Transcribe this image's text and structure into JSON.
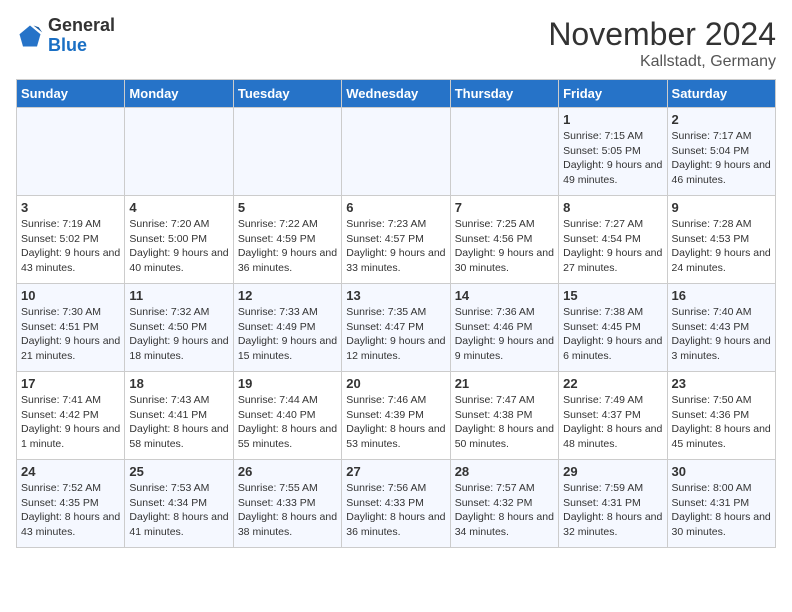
{
  "logo": {
    "general": "General",
    "blue": "Blue"
  },
  "header": {
    "month": "November 2024",
    "location": "Kallstadt, Germany"
  },
  "days_of_week": [
    "Sunday",
    "Monday",
    "Tuesday",
    "Wednesday",
    "Thursday",
    "Friday",
    "Saturday"
  ],
  "weeks": [
    [
      {
        "day": "",
        "info": ""
      },
      {
        "day": "",
        "info": ""
      },
      {
        "day": "",
        "info": ""
      },
      {
        "day": "",
        "info": ""
      },
      {
        "day": "",
        "info": ""
      },
      {
        "day": "1",
        "info": "Sunrise: 7:15 AM\nSunset: 5:05 PM\nDaylight: 9 hours and 49 minutes."
      },
      {
        "day": "2",
        "info": "Sunrise: 7:17 AM\nSunset: 5:04 PM\nDaylight: 9 hours and 46 minutes."
      }
    ],
    [
      {
        "day": "3",
        "info": "Sunrise: 7:19 AM\nSunset: 5:02 PM\nDaylight: 9 hours and 43 minutes."
      },
      {
        "day": "4",
        "info": "Sunrise: 7:20 AM\nSunset: 5:00 PM\nDaylight: 9 hours and 40 minutes."
      },
      {
        "day": "5",
        "info": "Sunrise: 7:22 AM\nSunset: 4:59 PM\nDaylight: 9 hours and 36 minutes."
      },
      {
        "day": "6",
        "info": "Sunrise: 7:23 AM\nSunset: 4:57 PM\nDaylight: 9 hours and 33 minutes."
      },
      {
        "day": "7",
        "info": "Sunrise: 7:25 AM\nSunset: 4:56 PM\nDaylight: 9 hours and 30 minutes."
      },
      {
        "day": "8",
        "info": "Sunrise: 7:27 AM\nSunset: 4:54 PM\nDaylight: 9 hours and 27 minutes."
      },
      {
        "day": "9",
        "info": "Sunrise: 7:28 AM\nSunset: 4:53 PM\nDaylight: 9 hours and 24 minutes."
      }
    ],
    [
      {
        "day": "10",
        "info": "Sunrise: 7:30 AM\nSunset: 4:51 PM\nDaylight: 9 hours and 21 minutes."
      },
      {
        "day": "11",
        "info": "Sunrise: 7:32 AM\nSunset: 4:50 PM\nDaylight: 9 hours and 18 minutes."
      },
      {
        "day": "12",
        "info": "Sunrise: 7:33 AM\nSunset: 4:49 PM\nDaylight: 9 hours and 15 minutes."
      },
      {
        "day": "13",
        "info": "Sunrise: 7:35 AM\nSunset: 4:47 PM\nDaylight: 9 hours and 12 minutes."
      },
      {
        "day": "14",
        "info": "Sunrise: 7:36 AM\nSunset: 4:46 PM\nDaylight: 9 hours and 9 minutes."
      },
      {
        "day": "15",
        "info": "Sunrise: 7:38 AM\nSunset: 4:45 PM\nDaylight: 9 hours and 6 minutes."
      },
      {
        "day": "16",
        "info": "Sunrise: 7:40 AM\nSunset: 4:43 PM\nDaylight: 9 hours and 3 minutes."
      }
    ],
    [
      {
        "day": "17",
        "info": "Sunrise: 7:41 AM\nSunset: 4:42 PM\nDaylight: 9 hours and 1 minute."
      },
      {
        "day": "18",
        "info": "Sunrise: 7:43 AM\nSunset: 4:41 PM\nDaylight: 8 hours and 58 minutes."
      },
      {
        "day": "19",
        "info": "Sunrise: 7:44 AM\nSunset: 4:40 PM\nDaylight: 8 hours and 55 minutes."
      },
      {
        "day": "20",
        "info": "Sunrise: 7:46 AM\nSunset: 4:39 PM\nDaylight: 8 hours and 53 minutes."
      },
      {
        "day": "21",
        "info": "Sunrise: 7:47 AM\nSunset: 4:38 PM\nDaylight: 8 hours and 50 minutes."
      },
      {
        "day": "22",
        "info": "Sunrise: 7:49 AM\nSunset: 4:37 PM\nDaylight: 8 hours and 48 minutes."
      },
      {
        "day": "23",
        "info": "Sunrise: 7:50 AM\nSunset: 4:36 PM\nDaylight: 8 hours and 45 minutes."
      }
    ],
    [
      {
        "day": "24",
        "info": "Sunrise: 7:52 AM\nSunset: 4:35 PM\nDaylight: 8 hours and 43 minutes."
      },
      {
        "day": "25",
        "info": "Sunrise: 7:53 AM\nSunset: 4:34 PM\nDaylight: 8 hours and 41 minutes."
      },
      {
        "day": "26",
        "info": "Sunrise: 7:55 AM\nSunset: 4:33 PM\nDaylight: 8 hours and 38 minutes."
      },
      {
        "day": "27",
        "info": "Sunrise: 7:56 AM\nSunset: 4:33 PM\nDaylight: 8 hours and 36 minutes."
      },
      {
        "day": "28",
        "info": "Sunrise: 7:57 AM\nSunset: 4:32 PM\nDaylight: 8 hours and 34 minutes."
      },
      {
        "day": "29",
        "info": "Sunrise: 7:59 AM\nSunset: 4:31 PM\nDaylight: 8 hours and 32 minutes."
      },
      {
        "day": "30",
        "info": "Sunrise: 8:00 AM\nSunset: 4:31 PM\nDaylight: 8 hours and 30 minutes."
      }
    ]
  ]
}
